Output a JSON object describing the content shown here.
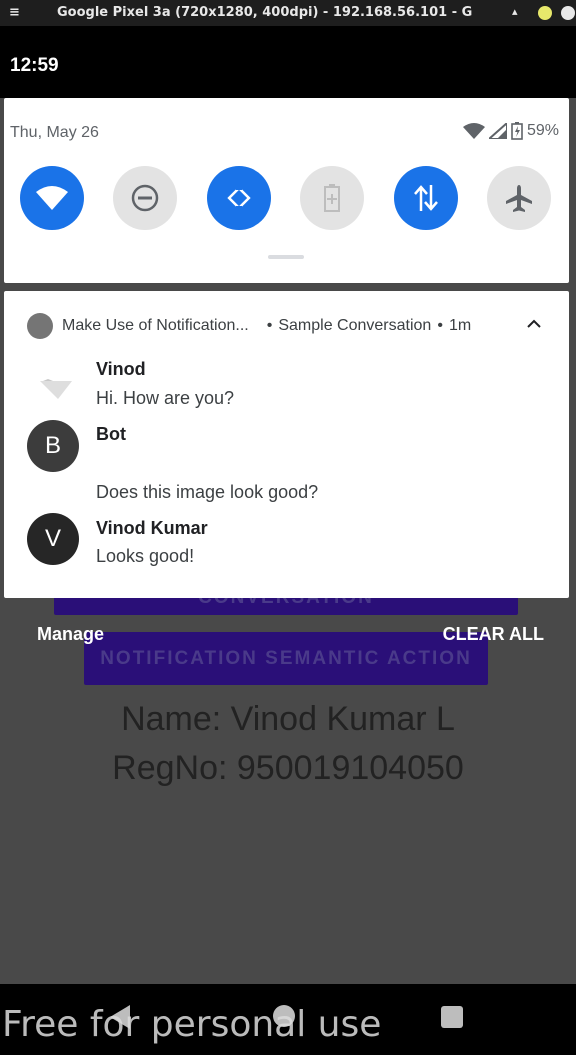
{
  "emulator": {
    "menu_icon": "hamburger-icon",
    "title": "Google Pixel 3a (720x1280, 400dpi) - 192.168.56.101 - G",
    "minimize_glyph": "–"
  },
  "status_bar": {
    "time": "12:59"
  },
  "quick_settings": {
    "date": "Thu, May 26",
    "battery": "59%",
    "tiles": [
      {
        "name": "wifi",
        "icon": "wifi-icon",
        "state": "on"
      },
      {
        "name": "do-not-disturb",
        "icon": "do-not-disturb-icon",
        "state": "off"
      },
      {
        "name": "auto-rotate",
        "icon": "auto-rotate-icon",
        "state": "on"
      },
      {
        "name": "battery-saver",
        "icon": "battery-saver-icon",
        "state": "off"
      },
      {
        "name": "mobile-data",
        "icon": "mobile-data-icon",
        "state": "on"
      },
      {
        "name": "airplane-mode",
        "icon": "airplane-icon",
        "state": "off"
      }
    ]
  },
  "notification": {
    "app_name": "Make Use of Notification...",
    "bullet": "•",
    "subtext": "Sample Conversation",
    "time": "1m",
    "messages": [
      {
        "sender": "Vinod",
        "text": "Hi. How are you?",
        "avatar": ""
      },
      {
        "sender": "Bot",
        "text": "",
        "avatar": "B"
      },
      {
        "sender": "",
        "text": "Does this image look good?",
        "avatar": ""
      },
      {
        "sender": "Vinod Kumar",
        "text": "Looks good!",
        "avatar": "V"
      }
    ]
  },
  "shade_actions": {
    "manage": "Manage",
    "clear_all": "CLEAR ALL"
  },
  "app": {
    "button_conversation": "CONVERSATION",
    "button_semantic": "NOTIFICATION SEMANTIC ACTION",
    "name_line": "Name: Vinod Kumar L",
    "regno_line": "RegNo: 950019104050"
  },
  "watermark": "Free for personal use",
  "colors": {
    "accent": "#1a73e8",
    "tile_off": "#e3e3e3",
    "purple": "#2a0f78"
  }
}
